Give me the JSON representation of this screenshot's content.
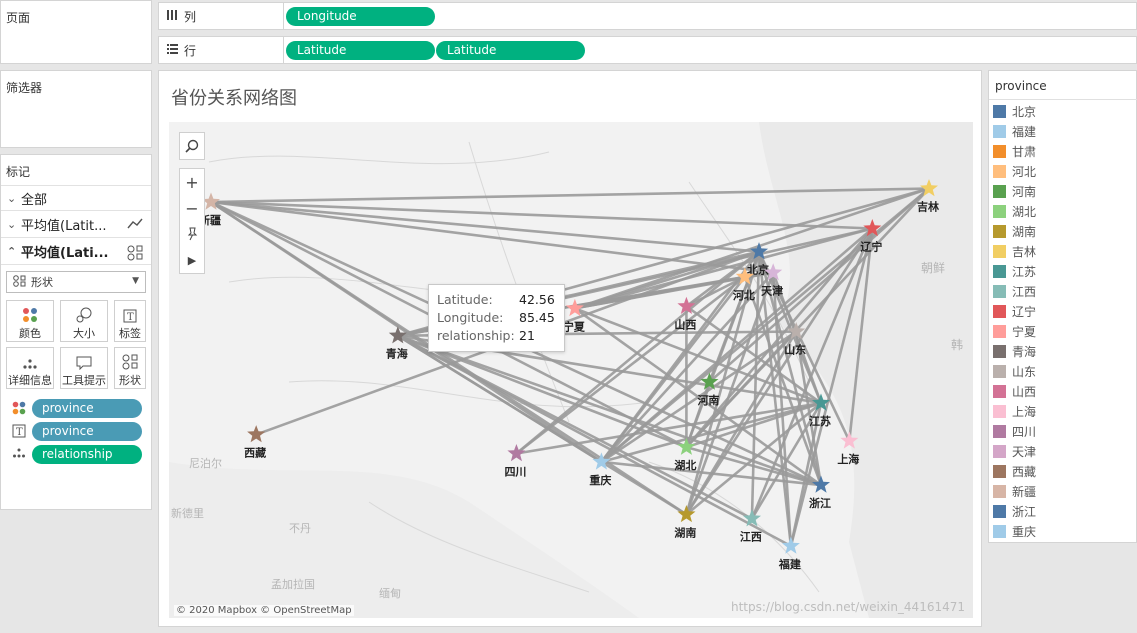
{
  "sidebar": {
    "pages_title": "页面",
    "filters_title": "筛选器",
    "marks_title": "标记",
    "all_label": "全部",
    "mark_layer1": "平均值(Latit...",
    "mark_layer2": "平均值(Lati...",
    "mark_type": "形状",
    "buttons": {
      "color": "颜色",
      "size": "大小",
      "label": "标签",
      "detail": "详细信息",
      "tooltip": "工具提示",
      "shape": "形状"
    },
    "fields": [
      {
        "name": "province",
        "color": "#4a9bb5"
      },
      {
        "name": "province",
        "color": "#4a9bb5"
      },
      {
        "name": "relationship",
        "color": "#00b180"
      }
    ]
  },
  "shelves": {
    "columns_label": "列",
    "rows_label": "行",
    "columns_pills": [
      "Longitude"
    ],
    "rows_pills": [
      "Latitude",
      "Latitude"
    ]
  },
  "view": {
    "title": "省份关系网络图",
    "attribution": "© 2020 Mapbox © OpenStreetMap",
    "watermark": "https://blog.csdn.net/weixin_44161471",
    "map_labels": [
      "朝鲜",
      "韩",
      "不丹",
      "孟加拉国",
      "缅甸",
      "尼泊尔",
      "新德里"
    ]
  },
  "tooltip": {
    "rows": [
      {
        "key": "Latitude:",
        "value": "42.56"
      },
      {
        "key": "Longitude:",
        "value": "85.45"
      },
      {
        "key": "relationship:",
        "value": "21"
      }
    ]
  },
  "chart_data": {
    "type": "network",
    "nodes": [
      {
        "name": "新疆",
        "lon": 85.45,
        "lat": 42.56,
        "color": "#d4b5a7"
      },
      {
        "name": "吉林",
        "lon": 126.0,
        "lat": 43.2,
        "color": "#f1ce63"
      },
      {
        "name": "辽宁",
        "lon": 122.8,
        "lat": 41.3,
        "color": "#e15759"
      },
      {
        "name": "北京",
        "lon": 116.4,
        "lat": 40.2,
        "color": "#4e79a7"
      },
      {
        "name": "天津",
        "lon": 117.2,
        "lat": 39.2,
        "color": "#d7b5d8"
      },
      {
        "name": "河北",
        "lon": 115.6,
        "lat": 39.0,
        "color": "#ffbe7d"
      },
      {
        "name": "宁夏",
        "lon": 106.0,
        "lat": 37.5,
        "color": "#ff9d9a"
      },
      {
        "name": "山西",
        "lon": 112.3,
        "lat": 37.6,
        "color": "#d37295"
      },
      {
        "name": "青海",
        "lon": 96.0,
        "lat": 36.2,
        "color": "#79706e"
      },
      {
        "name": "山东",
        "lon": 118.5,
        "lat": 36.4,
        "color": "#bab0ac"
      },
      {
        "name": "河南",
        "lon": 113.6,
        "lat": 34.0,
        "color": "#59a14f"
      },
      {
        "name": "江苏",
        "lon": 119.9,
        "lat": 33.0,
        "color": "#499894"
      },
      {
        "name": "西藏",
        "lon": 88.0,
        "lat": 31.5,
        "color": "#9d7660"
      },
      {
        "name": "上海",
        "lon": 121.5,
        "lat": 31.2,
        "color": "#fabfd2"
      },
      {
        "name": "湖北",
        "lon": 112.3,
        "lat": 30.9,
        "color": "#8cd17d"
      },
      {
        "name": "四川",
        "lon": 102.7,
        "lat": 30.6,
        "color": "#b07aa1"
      },
      {
        "name": "重庆",
        "lon": 107.5,
        "lat": 30.2,
        "color": "#a0cbe8"
      },
      {
        "name": "浙江",
        "lon": 119.9,
        "lat": 29.1,
        "color": "#4e79a7"
      },
      {
        "name": "湖南",
        "lon": 112.3,
        "lat": 27.7,
        "color": "#b6992d"
      },
      {
        "name": "江西",
        "lon": 116.0,
        "lat": 27.5,
        "color": "#86bcb6"
      },
      {
        "name": "福建",
        "lon": 118.2,
        "lat": 26.2,
        "color": "#a0cbe8"
      }
    ],
    "edges": [
      [
        "新疆",
        "吉林"
      ],
      [
        "新疆",
        "辽宁"
      ],
      [
        "新疆",
        "北京"
      ],
      [
        "新疆",
        "天津"
      ],
      [
        "新疆",
        "湖北"
      ],
      [
        "新疆",
        "重庆"
      ],
      [
        "新疆",
        "湖南"
      ],
      [
        "新疆",
        "浙江"
      ],
      [
        "青海",
        "吉林"
      ],
      [
        "青海",
        "辽宁"
      ],
      [
        "青海",
        "北京"
      ],
      [
        "青海",
        "河北"
      ],
      [
        "青海",
        "天津"
      ],
      [
        "青海",
        "山东"
      ],
      [
        "青海",
        "江苏"
      ],
      [
        "青海",
        "湖北"
      ],
      [
        "青海",
        "浙江"
      ],
      [
        "青海",
        "重庆"
      ],
      [
        "青海",
        "湖南"
      ],
      [
        "青海",
        "江西"
      ],
      [
        "青海",
        "福建"
      ],
      [
        "西藏",
        "北京"
      ],
      [
        "宁夏",
        "吉林"
      ],
      [
        "宁夏",
        "辽宁"
      ],
      [
        "宁夏",
        "北京"
      ],
      [
        "宁夏",
        "天津"
      ],
      [
        "宁夏",
        "河北"
      ],
      [
        "宁夏",
        "江苏"
      ],
      [
        "宁夏",
        "浙江"
      ],
      [
        "山西",
        "北京"
      ],
      [
        "山西",
        "湖北"
      ],
      [
        "山西",
        "江苏"
      ],
      [
        "山西",
        "河北"
      ],
      [
        "四川",
        "北京"
      ],
      [
        "四川",
        "河北"
      ],
      [
        "四川",
        "江苏"
      ],
      [
        "重庆",
        "北京"
      ],
      [
        "重庆",
        "河北"
      ],
      [
        "重庆",
        "天津"
      ],
      [
        "重庆",
        "辽宁"
      ],
      [
        "重庆",
        "吉林"
      ],
      [
        "重庆",
        "江苏"
      ],
      [
        "重庆",
        "浙江"
      ],
      [
        "重庆",
        "山东"
      ],
      [
        "湖北",
        "北京"
      ],
      [
        "湖北",
        "辽宁"
      ],
      [
        "湖北",
        "吉林"
      ],
      [
        "湖北",
        "江苏"
      ],
      [
        "湖北",
        "浙江"
      ],
      [
        "湖北",
        "山东"
      ],
      [
        "湖南",
        "北京"
      ],
      [
        "湖南",
        "天津"
      ],
      [
        "湖南",
        "辽宁"
      ],
      [
        "湖南",
        "江苏"
      ],
      [
        "湖南",
        "山东"
      ],
      [
        "江西",
        "北京"
      ],
      [
        "江西",
        "辽宁"
      ],
      [
        "江西",
        "江苏"
      ],
      [
        "福建",
        "北京"
      ],
      [
        "福建",
        "辽宁"
      ],
      [
        "福建",
        "天津"
      ],
      [
        "福建",
        "江苏"
      ],
      [
        "河南",
        "北京"
      ],
      [
        "河南",
        "吉林"
      ],
      [
        "河南",
        "湖北"
      ],
      [
        "北京",
        "江苏"
      ],
      [
        "北京",
        "浙江"
      ],
      [
        "天津",
        "江苏"
      ],
      [
        "河北",
        "浙江"
      ],
      [
        "山东",
        "浙江"
      ],
      [
        "上海",
        "辽宁"
      ],
      [
        "上海",
        "北京"
      ]
    ]
  },
  "legend": {
    "title": "province",
    "items": [
      {
        "name": "北京",
        "color": "#4e79a7"
      },
      {
        "name": "福建",
        "color": "#a0cbe8"
      },
      {
        "name": "甘肃",
        "color": "#f28e2b"
      },
      {
        "name": "河北",
        "color": "#ffbe7d"
      },
      {
        "name": "河南",
        "color": "#59a14f"
      },
      {
        "name": "湖北",
        "color": "#8cd17d"
      },
      {
        "name": "湖南",
        "color": "#b6992d"
      },
      {
        "name": "吉林",
        "color": "#f1ce63"
      },
      {
        "name": "江苏",
        "color": "#499894"
      },
      {
        "name": "江西",
        "color": "#86bcb6"
      },
      {
        "name": "辽宁",
        "color": "#e15759"
      },
      {
        "name": "宁夏",
        "color": "#ff9d9a"
      },
      {
        "name": "青海",
        "color": "#79706e"
      },
      {
        "name": "山东",
        "color": "#bab0ac"
      },
      {
        "name": "山西",
        "color": "#d37295"
      },
      {
        "name": "上海",
        "color": "#fabfd2"
      },
      {
        "name": "四川",
        "color": "#b07aa1"
      },
      {
        "name": "天津",
        "color": "#d4a6c8"
      },
      {
        "name": "西藏",
        "color": "#9d7660"
      },
      {
        "name": "新疆",
        "color": "#d7b5a6"
      },
      {
        "name": "浙江",
        "color": "#4e79a7"
      },
      {
        "name": "重庆",
        "color": "#a0cbe8"
      }
    ]
  }
}
